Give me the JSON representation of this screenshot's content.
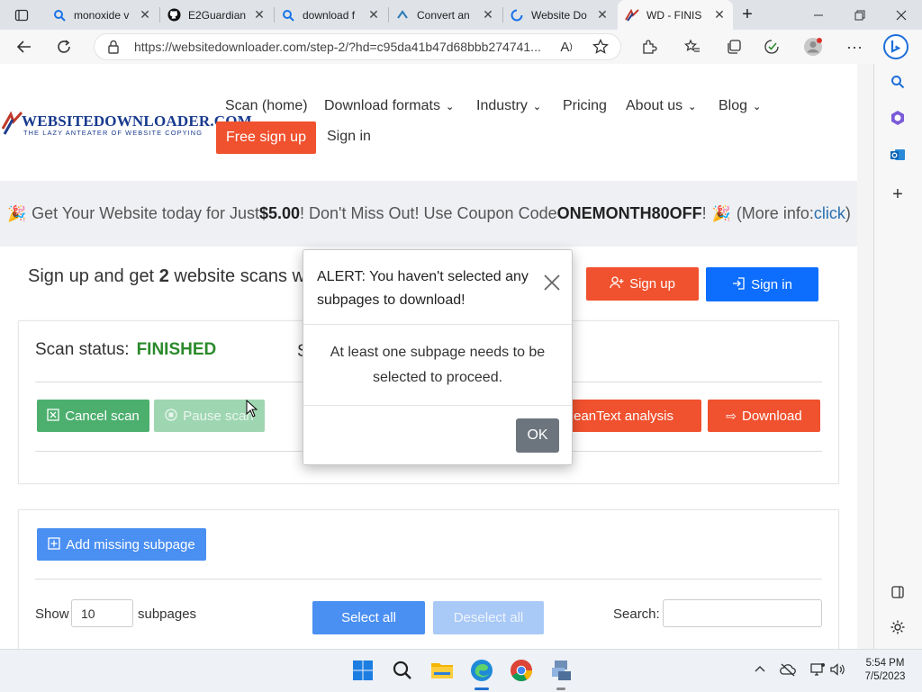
{
  "browser": {
    "tabs": [
      {
        "title": "monoxide v",
        "icon": "search-icon",
        "active": false
      },
      {
        "title": "E2Guardian",
        "icon": "github-icon",
        "active": false
      },
      {
        "title": "download f",
        "icon": "search-icon",
        "active": false
      },
      {
        "title": "Convert an",
        "icon": "convert-icon",
        "active": false
      },
      {
        "title": "Website Do",
        "icon": "loading-icon",
        "active": false
      },
      {
        "title": "WD - FINIS",
        "icon": "wd-logo-icon",
        "active": true
      }
    ],
    "new_tab_label": "+",
    "url": "https://websitedownloader.com/step-2/?hd=c95da41b47d68bbb274741..."
  },
  "site": {
    "logo_text": "WEBSITEDOWNLOADER.COM",
    "logo_tagline": "THE LAZY ANTEATER OF WEBSITE COPYING",
    "nav": {
      "scan": "Scan (home)",
      "formats": "Download formats",
      "industry": "Industry",
      "pricing": "Pricing",
      "about": "About us",
      "blog": "Blog",
      "free_signup": "Free sign up",
      "sign_in": "Sign in"
    },
    "promo": {
      "emoji": "🎉",
      "text1": "Get Your Website today for Just ",
      "price": "$5.00",
      "text2": "! Don't Miss Out! Use Coupon Code ",
      "code": "ONEMONTH80OFF",
      "text3": "! ",
      "more_prefix": " (More info: ",
      "more_link": "click",
      "more_suffix": ")"
    },
    "signup_banner": {
      "prefix": "Sign up and get ",
      "count": "2",
      "suffix": " website scans w",
      "signup_btn": "Sign up",
      "signin_btn": "Sign in"
    },
    "scan": {
      "status_label": "Scan status:",
      "status_value": "FINISHED",
      "partial_char": "S",
      "cancel_btn": "Cancel scan",
      "pause_btn": "Pause scan",
      "cleantext_btn": "CleanText analysis",
      "download_btn": "Download"
    },
    "subpages": {
      "add_btn": "Add missing subpage",
      "show_label": "Show",
      "show_value": "10",
      "subpages_label": "subpages",
      "select_all": "Select all",
      "deselect_all": "Deselect all",
      "search_label": "Search:",
      "search_value": ""
    }
  },
  "modal": {
    "title": "ALERT: You haven't selected any subpages to download!",
    "body": "At least one subpage needs to be selected to proceed.",
    "ok": "OK"
  },
  "taskbar": {
    "time": "5:54 PM",
    "date": "7/5/2023"
  },
  "colors": {
    "orange": "#f0512e",
    "blue": "#0d6efd",
    "green": "#4caf6e",
    "modal_ok": "#6c757d",
    "status_green": "#2b8a2b"
  }
}
